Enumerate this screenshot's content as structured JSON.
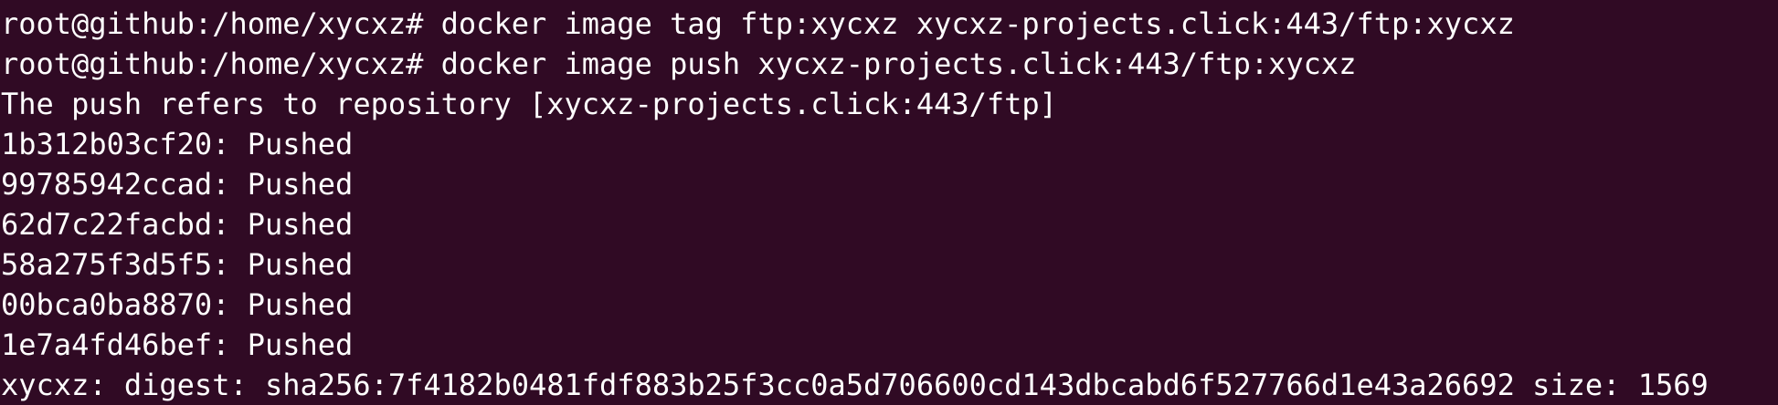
{
  "terminal": {
    "background": "#300a24",
    "foreground": "#ffffff",
    "lines": [
      "root@github:/home/xycxz# docker image tag ftp:xycxz xycxz-projects.click:443/ftp:xycxz",
      "root@github:/home/xycxz# docker image push xycxz-projects.click:443/ftp:xycxz",
      "The push refers to repository [xycxz-projects.click:443/ftp]",
      "1b312b03cf20: Pushed",
      "99785942ccad: Pushed",
      "62d7c22facbd: Pushed",
      "58a275f3d5f5: Pushed",
      "00bca0ba8870: Pushed",
      "1e7a4fd46bef: Pushed",
      "xycxz: digest: sha256:7f4182b0481fdf883b25f3cc0a5d706600cd143dbcabd6f527766d1e43a26692 size: 1569"
    ]
  }
}
